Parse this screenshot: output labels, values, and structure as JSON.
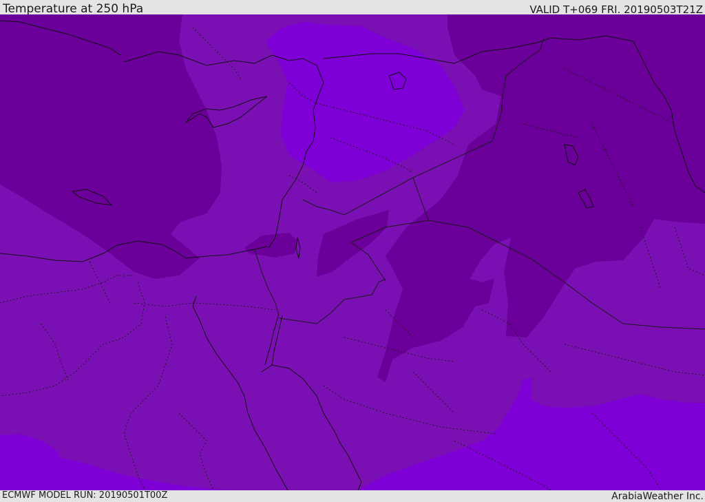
{
  "header": {
    "title": "Temperature at 250 hPa",
    "valid": "VALID T+069 FRI. 20190503T21Z"
  },
  "footer": {
    "model_run": "ECMWF MODEL RUN: 20190501T00Z",
    "credit": "ArabiaWeather Inc."
  },
  "map": {
    "field": "temperature-250hPa",
    "colors": {
      "cold": "#6a0099",
      "medium": "#7a10b3",
      "warm": "#7e00d6",
      "coastline": "#111111",
      "border": "#1a1a1a"
    }
  }
}
